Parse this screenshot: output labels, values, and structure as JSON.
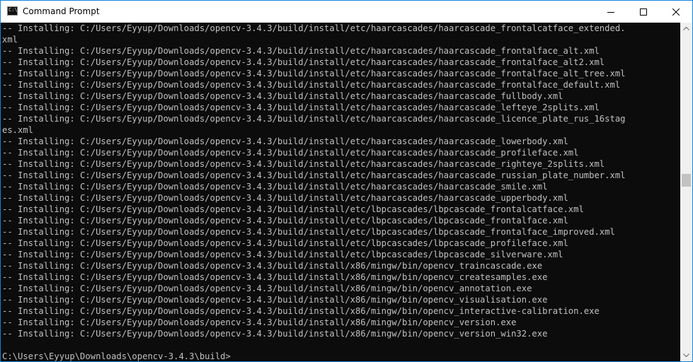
{
  "window": {
    "title": "Command Prompt",
    "icon": "cmd-icon",
    "icon_text": "C:\\"
  },
  "controls": {
    "minimize": "minimize-icon",
    "maximize": "maximize-icon",
    "close": "close-icon"
  },
  "console": {
    "lines": [
      "-- Installing: C:/Users/Eyyup/Downloads/opencv-3.4.3/build/install/etc/haarcascades/haarcascade_frontalcatface_extended.",
      "xml",
      "-- Installing: C:/Users/Eyyup/Downloads/opencv-3.4.3/build/install/etc/haarcascades/haarcascade_frontalface_alt.xml",
      "-- Installing: C:/Users/Eyyup/Downloads/opencv-3.4.3/build/install/etc/haarcascades/haarcascade_frontalface_alt2.xml",
      "-- Installing: C:/Users/Eyyup/Downloads/opencv-3.4.3/build/install/etc/haarcascades/haarcascade_frontalface_alt_tree.xml",
      "-- Installing: C:/Users/Eyyup/Downloads/opencv-3.4.3/build/install/etc/haarcascades/haarcascade_frontalface_default.xml",
      "-- Installing: C:/Users/Eyyup/Downloads/opencv-3.4.3/build/install/etc/haarcascades/haarcascade_fullbody.xml",
      "-- Installing: C:/Users/Eyyup/Downloads/opencv-3.4.3/build/install/etc/haarcascades/haarcascade_lefteye_2splits.xml",
      "-- Installing: C:/Users/Eyyup/Downloads/opencv-3.4.3/build/install/etc/haarcascades/haarcascade_licence_plate_rus_16stag",
      "es.xml",
      "-- Installing: C:/Users/Eyyup/Downloads/opencv-3.4.3/build/install/etc/haarcascades/haarcascade_lowerbody.xml",
      "-- Installing: C:/Users/Eyyup/Downloads/opencv-3.4.3/build/install/etc/haarcascades/haarcascade_profileface.xml",
      "-- Installing: C:/Users/Eyyup/Downloads/opencv-3.4.3/build/install/etc/haarcascades/haarcascade_righteye_2splits.xml",
      "-- Installing: C:/Users/Eyyup/Downloads/opencv-3.4.3/build/install/etc/haarcascades/haarcascade_russian_plate_number.xml",
      "-- Installing: C:/Users/Eyyup/Downloads/opencv-3.4.3/build/install/etc/haarcascades/haarcascade_smile.xml",
      "-- Installing: C:/Users/Eyyup/Downloads/opencv-3.4.3/build/install/etc/haarcascades/haarcascade_upperbody.xml",
      "-- Installing: C:/Users/Eyyup/Downloads/opencv-3.4.3/build/install/etc/lbpcascades/lbpcascade_frontalcatface.xml",
      "-- Installing: C:/Users/Eyyup/Downloads/opencv-3.4.3/build/install/etc/lbpcascades/lbpcascade_frontalface.xml",
      "-- Installing: C:/Users/Eyyup/Downloads/opencv-3.4.3/build/install/etc/lbpcascades/lbpcascade_frontalface_improved.xml",
      "-- Installing: C:/Users/Eyyup/Downloads/opencv-3.4.3/build/install/etc/lbpcascades/lbpcascade_profileface.xml",
      "-- Installing: C:/Users/Eyyup/Downloads/opencv-3.4.3/build/install/etc/lbpcascades/lbpcascade_silverware.xml",
      "-- Installing: C:/Users/Eyyup/Downloads/opencv-3.4.3/build/install/x86/mingw/bin/opencv_traincascade.exe",
      "-- Installing: C:/Users/Eyyup/Downloads/opencv-3.4.3/build/install/x86/mingw/bin/opencv_createsamples.exe",
      "-- Installing: C:/Users/Eyyup/Downloads/opencv-3.4.3/build/install/x86/mingw/bin/opencv_annotation.exe",
      "-- Installing: C:/Users/Eyyup/Downloads/opencv-3.4.3/build/install/x86/mingw/bin/opencv_visualisation.exe",
      "-- Installing: C:/Users/Eyyup/Downloads/opencv-3.4.3/build/install/x86/mingw/bin/opencv_interactive-calibration.exe",
      "-- Installing: C:/Users/Eyyup/Downloads/opencv-3.4.3/build/install/x86/mingw/bin/opencv_version.exe",
      "-- Installing: C:/Users/Eyyup/Downloads/opencv-3.4.3/build/install/x86/mingw/bin/opencv_version_win32.exe",
      "",
      "C:\\Users\\Eyyup\\Downloads\\opencv-3.4.3\\build>"
    ]
  },
  "scrollbar": {
    "up_icon": "scroll-up-arrow-icon",
    "down_icon": "scroll-down-arrow-icon"
  },
  "colors": {
    "console_bg": "#0c0c0c",
    "console_text": "#c0c0c0",
    "window_border": "#1883d7"
  }
}
